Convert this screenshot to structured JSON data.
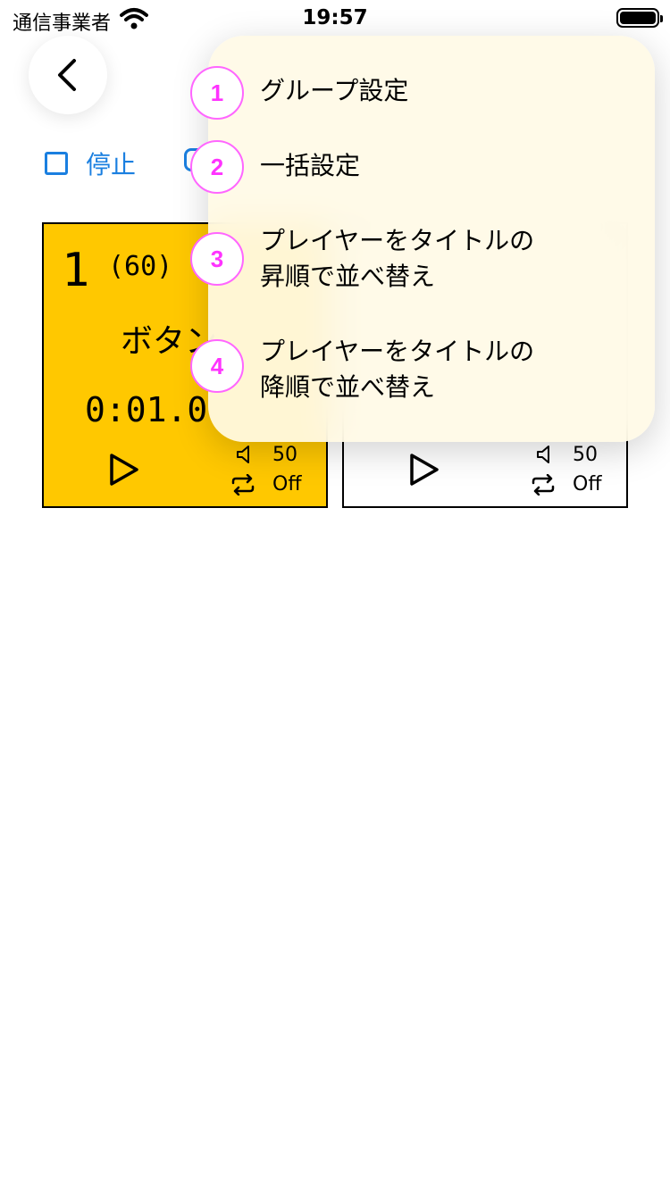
{
  "status_bar": {
    "carrier": "通信事業者",
    "time": "19:57"
  },
  "toolbar": {
    "stop_label": "停止"
  },
  "cards": [
    {
      "number": "1",
      "count": "(60)",
      "title": "ボタン",
      "time": "0:01.0",
      "volume": "50",
      "repeat": "Off",
      "color": "#ffc800"
    },
    {
      "volume": "50",
      "repeat": "Off",
      "color": "#ffffff"
    }
  ],
  "menu": {
    "items": [
      {
        "lines": [
          "グループ設定"
        ]
      },
      {
        "lines": [
          "一括設定"
        ]
      },
      {
        "lines": [
          "プレイヤーをタイトルの",
          "昇順で並べ替え"
        ]
      },
      {
        "lines": [
          "プレイヤーをタイトルの",
          "降順で並べ替え"
        ]
      }
    ]
  },
  "callouts": [
    "1",
    "2",
    "3",
    "4"
  ],
  "colors": {
    "accent_blue": "#1a7fe0",
    "callout_magenta": "#ff33ff",
    "card_yellow": "#ffc800"
  },
  "icons": {
    "back": "chevron-left-icon",
    "wifi": "wifi-icon",
    "battery": "battery-icon",
    "checkbox": "checkbox-icon",
    "play": "play-icon",
    "volume": "speaker-icon",
    "repeat": "repeat-icon"
  }
}
